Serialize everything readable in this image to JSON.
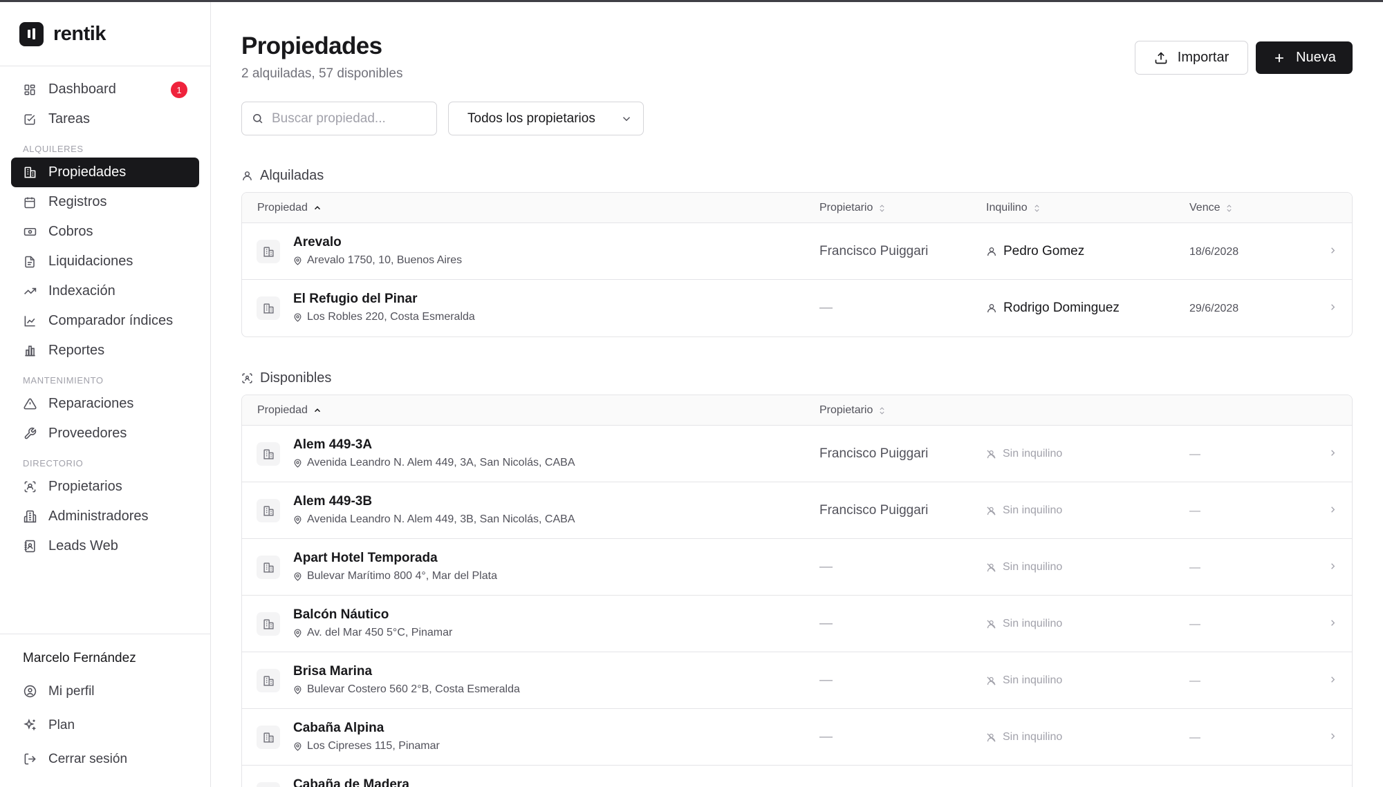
{
  "app": {
    "name": "rentik"
  },
  "sidebar": {
    "items": [
      {
        "label": "Dashboard",
        "icon": "dashboard-icon",
        "badge": "1"
      },
      {
        "label": "Tareas",
        "icon": "tasks-icon"
      }
    ],
    "sections": [
      {
        "title": "ALQUILERES",
        "items": [
          {
            "label": "Propiedades",
            "icon": "building-icon",
            "active": true
          },
          {
            "label": "Registros",
            "icon": "calendar-icon"
          },
          {
            "label": "Cobros",
            "icon": "banknote-icon"
          },
          {
            "label": "Liquidaciones",
            "icon": "file-icon"
          },
          {
            "label": "Indexación",
            "icon": "trending-up-icon"
          },
          {
            "label": "Comparador índices",
            "icon": "area-chart-icon"
          },
          {
            "label": "Reportes",
            "icon": "bar-chart-icon"
          }
        ]
      },
      {
        "title": "MANTENIMIENTO",
        "items": [
          {
            "label": "Reparaciones",
            "icon": "warning-icon"
          },
          {
            "label": "Proveedores",
            "icon": "wrench-icon"
          }
        ]
      },
      {
        "title": "DIRECTORIO",
        "items": [
          {
            "label": "Propietarios",
            "icon": "scan-user-icon"
          },
          {
            "label": "Administradores",
            "icon": "building-office-icon"
          },
          {
            "label": "Leads Web",
            "icon": "contact-book-icon"
          }
        ]
      }
    ],
    "footer": {
      "user_name": "Marcelo Fernández",
      "items": [
        {
          "label": "Mi perfil",
          "icon": "user-circle-icon"
        },
        {
          "label": "Plan",
          "icon": "sparkles-icon"
        },
        {
          "label": "Cerrar sesión",
          "icon": "logout-icon"
        }
      ]
    }
  },
  "header": {
    "title": "Propiedades",
    "subtitle": "2 alquiladas, 57 disponibles",
    "import_label": "Importar",
    "new_label": "Nueva"
  },
  "filters": {
    "search_placeholder": "Buscar propiedad...",
    "owner_select": "Todos los propietarios"
  },
  "rented": {
    "title": "Alquiladas",
    "columns": {
      "property": "Propiedad",
      "owner": "Propietario",
      "tenant": "Inquilino",
      "due": "Vence"
    },
    "rows": [
      {
        "name": "Arevalo",
        "address": "Arevalo 1750, 10, Buenos Aires",
        "owner": "Francisco Puiggari",
        "tenant": "Pedro Gomez",
        "due": "18/6/2028"
      },
      {
        "name": "El Refugio del Pinar",
        "address": "Los Robles 220, Costa Esmeralda",
        "owner": "—",
        "tenant": "Rodrigo Dominguez",
        "due": "29/6/2028"
      }
    ]
  },
  "available": {
    "title": "Disponibles",
    "columns": {
      "property": "Propiedad",
      "owner": "Propietario"
    },
    "no_tenant": "Sin inquilino",
    "empty_due": "—",
    "rows": [
      {
        "name": "Alem 449-3A",
        "address": "Avenida Leandro N. Alem 449, 3A, San Nicolás, CABA",
        "owner": "Francisco Puiggari"
      },
      {
        "name": "Alem 449-3B",
        "address": "Avenida Leandro N. Alem 449, 3B, San Nicolás, CABA",
        "owner": "Francisco Puiggari"
      },
      {
        "name": "Apart Hotel Temporada",
        "address": "Bulevar Marítimo 800 4°, Mar del Plata",
        "owner": "—"
      },
      {
        "name": "Balcón Náutico",
        "address": "Av. del Mar 450 5°C, Pinamar",
        "owner": "—"
      },
      {
        "name": "Brisa Marina",
        "address": "Bulevar Costero 560 2°B, Costa Esmeralda",
        "owner": "—"
      },
      {
        "name": "Cabaña Alpina",
        "address": "Los Cipreses 115, Pinamar",
        "owner": "—"
      },
      {
        "name": "Cabaña de Madera",
        "address": "",
        "owner": "—"
      }
    ]
  }
}
